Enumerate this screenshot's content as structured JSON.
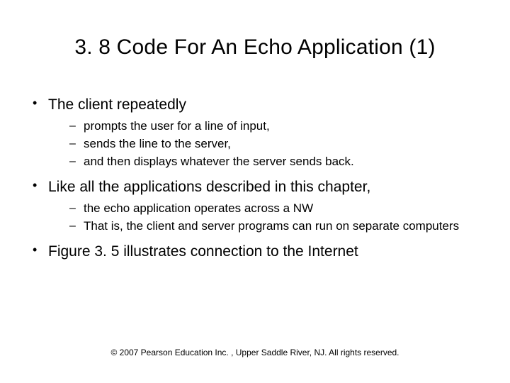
{
  "title": "3. 8 Code For An Echo Application (1)",
  "bullets": [
    {
      "text": "The client repeatedly",
      "sub": [
        "prompts the user for a line of input,",
        "sends the line to the server,",
        "and then displays whatever the server sends back."
      ]
    },
    {
      "text": "Like all the applications described in this chapter,",
      "sub": [
        "the echo application operates across a NW",
        "That is, the client and server programs can run on separate computers"
      ]
    },
    {
      "text": "Figure 3. 5 illustrates connection to the Internet",
      "sub": []
    }
  ],
  "footer": "© 2007 Pearson Education Inc. , Upper Saddle River, NJ. All rights reserved."
}
